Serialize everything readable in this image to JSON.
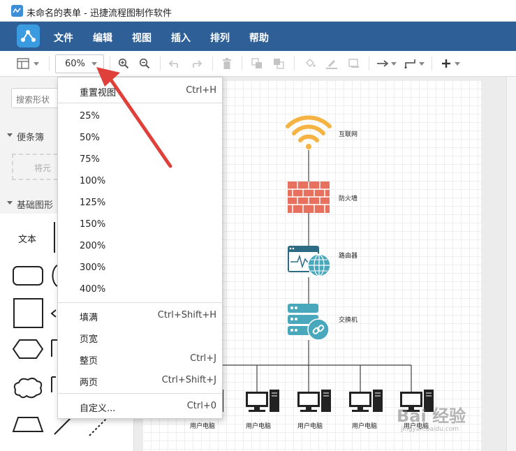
{
  "window": {
    "title": "未命名的表单 - 迅捷流程图制作软件"
  },
  "menubar": {
    "items": [
      "文件",
      "编辑",
      "视图",
      "插入",
      "排列",
      "帮助"
    ]
  },
  "toolbar": {
    "zoom_value": "60%"
  },
  "sidebar": {
    "search_placeholder": "搜索形状",
    "sticky_section": "便条簿",
    "sticky_hint": "将元",
    "basic_section": "基础图形",
    "text_shape": "文本"
  },
  "zoom_menu": {
    "reset": {
      "label": "重置视图",
      "shortcut": "Ctrl+H"
    },
    "levels": [
      "25%",
      "50%",
      "75%",
      "100%",
      "125%",
      "150%",
      "200%",
      "300%",
      "400%"
    ],
    "fill": {
      "label": "填满",
      "shortcut": "Ctrl+Shift+H"
    },
    "page_width": {
      "label": "页宽",
      "shortcut": ""
    },
    "whole_page": {
      "label": "整页",
      "shortcut": "Ctrl+J"
    },
    "two_pages": {
      "label": "两页",
      "shortcut": "Ctrl+Shift+J"
    },
    "custom": {
      "label": "自定义...",
      "shortcut": "Ctrl+0"
    }
  },
  "diagram": {
    "internet": "互联网",
    "firewall": "防火墙",
    "router": "路由器",
    "switch": "交换机",
    "pc_label": "用户电脑"
  },
  "watermark": {
    "main": "Bai 经验",
    "sub": "jingyan.baidu.com"
  },
  "colors": {
    "menubar": "#2e5f97",
    "wifi": "#f5b343",
    "firewall": "#e8705e",
    "device": "#2d6b85",
    "globe": "#4aa8bd",
    "arrow": "#e0403a"
  }
}
